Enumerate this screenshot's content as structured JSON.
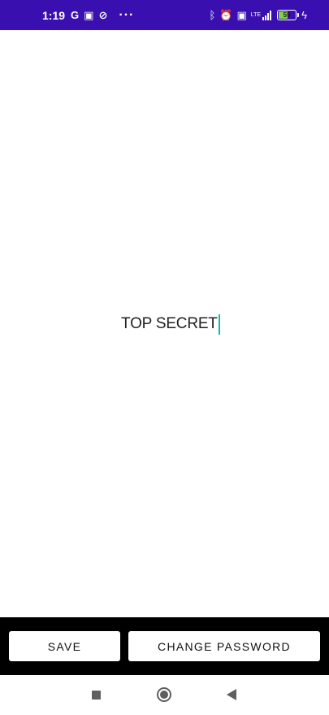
{
  "status_bar": {
    "time": "1:19",
    "left_icons": [
      {
        "name": "google-icon",
        "glyph": "G"
      },
      {
        "name": "grid-app-icon",
        "glyph": "▣"
      },
      {
        "name": "data-saver-icon",
        "glyph": "⊘"
      }
    ],
    "more": "···",
    "right_icons": [
      {
        "name": "bluetooth-icon",
        "glyph": "ᛒ"
      },
      {
        "name": "alarm-off-icon",
        "glyph": "⏰"
      },
      {
        "name": "volte-icon",
        "glyph": "▣"
      }
    ],
    "network_label": "LTE",
    "battery_level": "59",
    "battery_fraction": 0.59,
    "charging_glyph": "ϟ"
  },
  "editor": {
    "text": "TOP SECRET"
  },
  "actions": {
    "save_label": "SAVE",
    "change_password_label": "CHANGE PASSWORD"
  },
  "colors": {
    "status_bar": "#3a0fb0",
    "caret": "#14b8a6",
    "action_bar": "#000000",
    "battery_fill": "#7fd14a"
  }
}
